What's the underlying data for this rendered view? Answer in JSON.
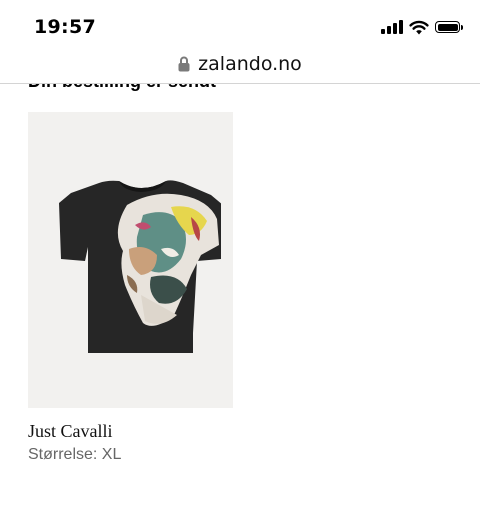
{
  "status_bar": {
    "time": "19:57",
    "icons": [
      "signal-icon",
      "wifi-icon",
      "battery-icon"
    ]
  },
  "browser": {
    "url": "zalando.no",
    "secure_icon": "lock-icon"
  },
  "page": {
    "heading": "Din bestilling er sendt"
  },
  "product": {
    "brand": "Just Cavalli",
    "size_label": "Størrelse:",
    "size_value": "XL",
    "image_icon": "t-shirt-image",
    "colors": {
      "shirt": "#262626",
      "image_background": "#f2f1ef"
    }
  }
}
